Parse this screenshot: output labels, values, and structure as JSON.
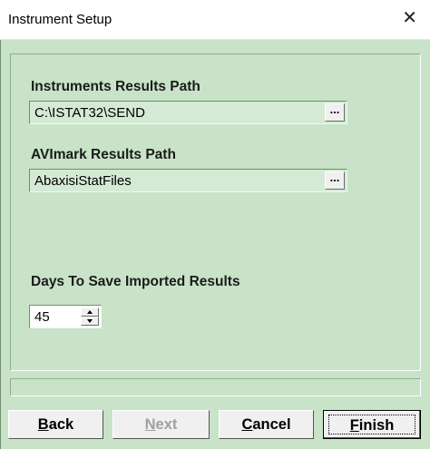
{
  "window": {
    "title": "Instrument Setup",
    "close_label": "✕"
  },
  "instruments_path": {
    "label": "Instruments Results Path",
    "value": "C:\\ISTAT32\\SEND",
    "browse_label": "..."
  },
  "avimark_path": {
    "label": "AVImark Results Path",
    "value": "AbaxisiStatFiles",
    "browse_label": "..."
  },
  "days_to_save": {
    "label": "Days To Save Imported Results",
    "value": "45"
  },
  "buttons": {
    "back": {
      "mnemonic": "B",
      "rest": "ack"
    },
    "next": {
      "mnemonic": "N",
      "rest": "ext"
    },
    "cancel": {
      "mnemonic": "C",
      "rest": "ancel"
    },
    "finish": {
      "mnemonic": "F",
      "rest": "inish"
    }
  },
  "colors": {
    "dialog_background": "#c8e3c8",
    "button_face": "#f0f0f0"
  }
}
